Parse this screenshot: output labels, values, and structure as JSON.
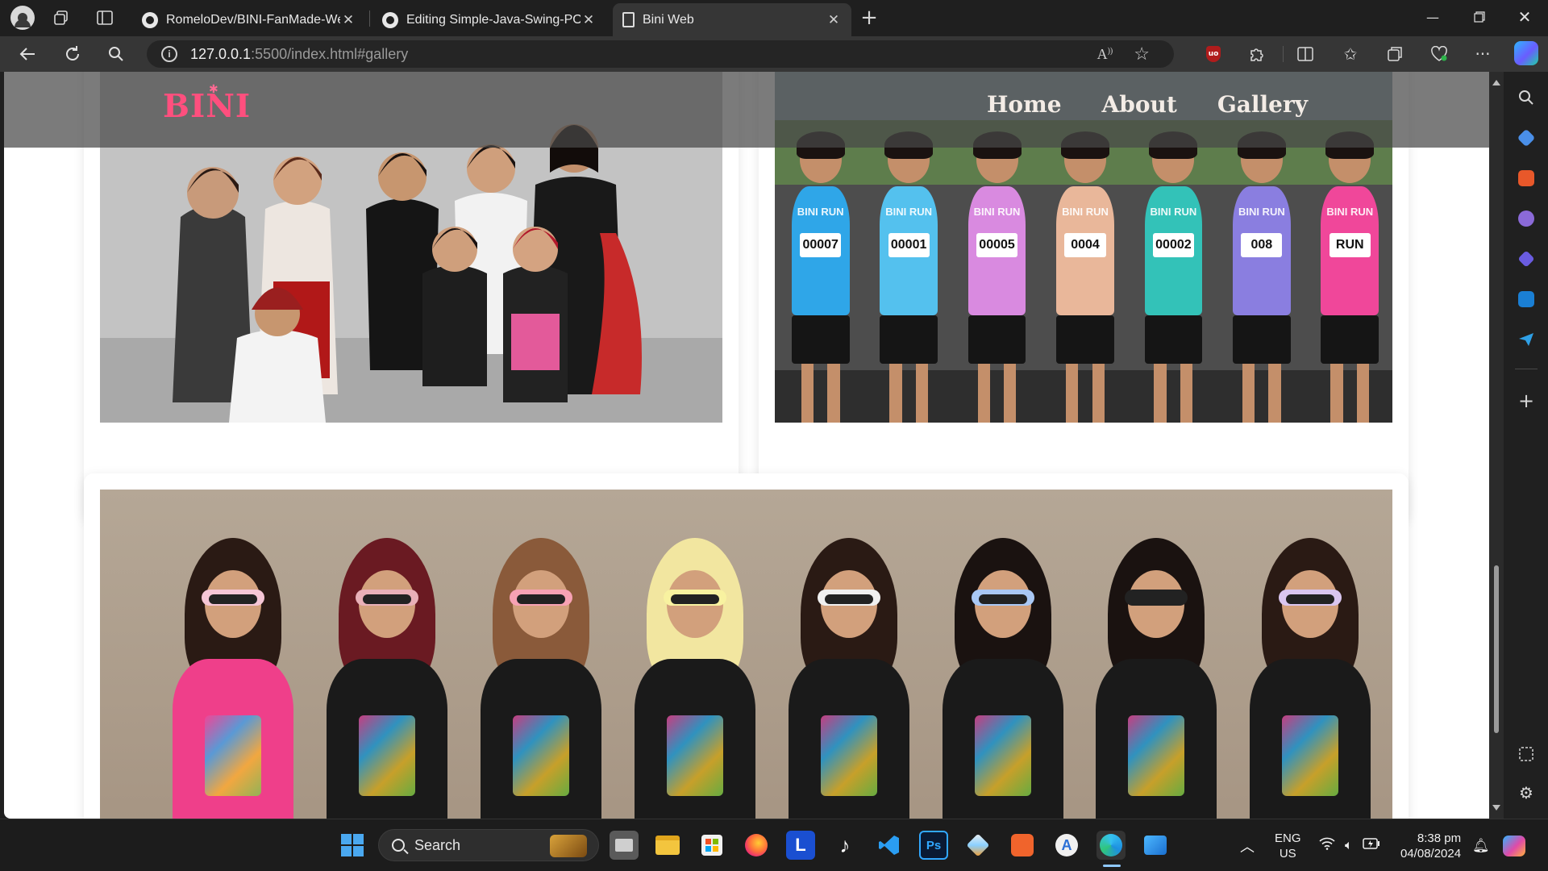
{
  "browser": {
    "tabs": [
      {
        "title": "RomeloDev/BINI-FanMade-Websi",
        "icon": "github-icon"
      },
      {
        "title": "Editing Simple-Java-Swing-POS-",
        "icon": "github-icon"
      },
      {
        "title": "Bini Web",
        "icon": "page-icon",
        "active": true
      }
    ],
    "url_host": "127.0.0.1",
    "url_rest": ":5500/index.html#gallery",
    "ublock_badge": "uo",
    "window_controls": [
      "minimize",
      "restore",
      "close"
    ]
  },
  "site": {
    "logo": "BINI",
    "nav": [
      {
        "label": "Home"
      },
      {
        "label": "About"
      },
      {
        "label": "Gallery"
      }
    ],
    "colors": {
      "logo": "#ff4f7e",
      "nav_text": "#f3ece6",
      "header_bg": "rgba(72,72,72,0.72)"
    }
  },
  "gallery": {
    "photos": [
      {
        "name": "group-studio-photo"
      },
      {
        "name": "bini-run-photo",
        "bibs": [
          "00007",
          "00001",
          "00005",
          "0004",
          "00002",
          "008",
          "RUN"
        ],
        "shirt_text": "BINI RUN"
      },
      {
        "name": "group-sunglasses-photo"
      }
    ]
  },
  "taskbar": {
    "search_placeholder": "Search",
    "lang_line1": "ENG",
    "lang_line2": "US",
    "time": "8:38 pm",
    "date": "04/08/2024",
    "app_letter_l": "L",
    "app_ps": "Ps"
  }
}
